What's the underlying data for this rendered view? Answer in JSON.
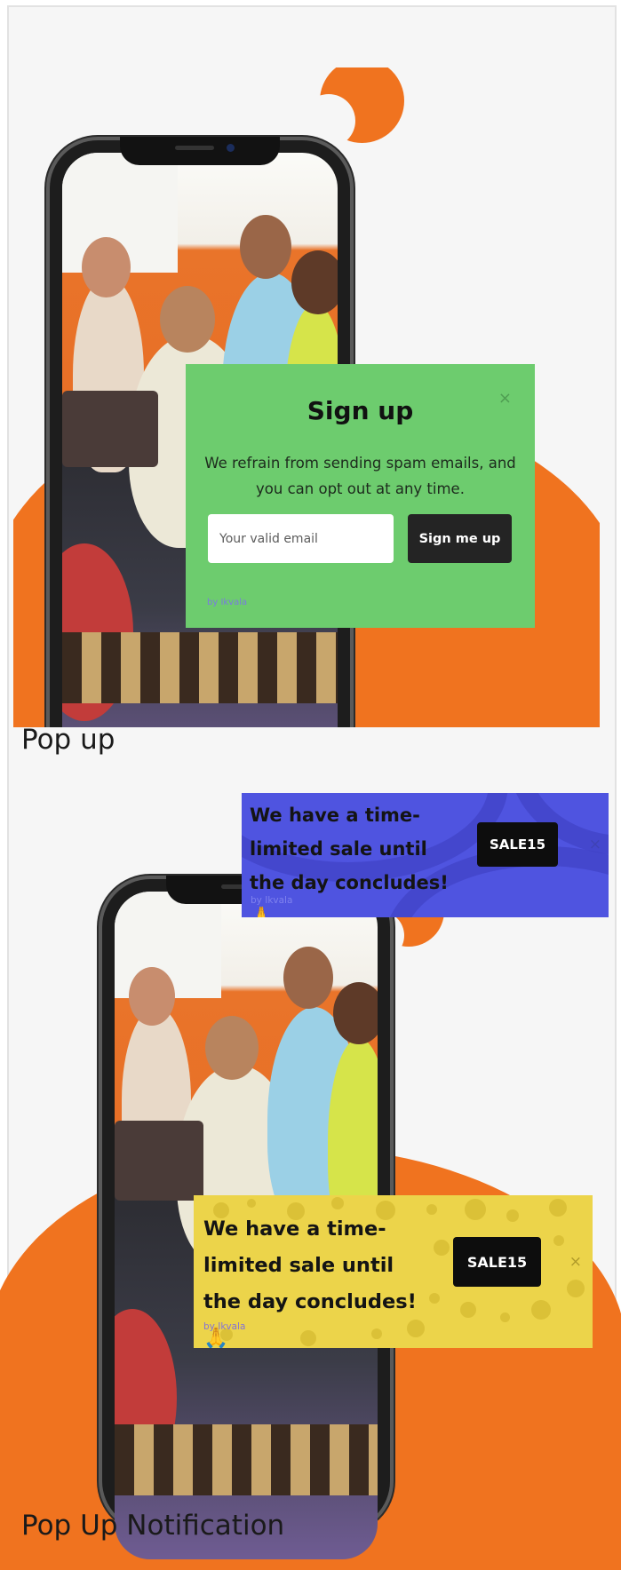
{
  "colors": {
    "accent_orange": "#f0731f",
    "signup_bg": "#6dcc6e",
    "sale_blue_bg": "#4f54e0",
    "sale_yellow_bg": "#ecd44a",
    "button_dark": "#242424"
  },
  "examples": [
    {
      "label": "Pop up",
      "signup": {
        "title": "Sign up",
        "description": "We refrain from sending spam emails, and you can opt out at any time.",
        "email_placeholder": "Your valid email",
        "submit_label": "Sign me up",
        "close_icon": "×",
        "branding": "by Ikvala"
      }
    },
    {
      "label": "Pop Up Notification",
      "notifications": [
        {
          "text": "We have a time-limited sale until the day concludes! 🙏",
          "code_label": "SALE15",
          "close_icon": "×",
          "branding": "by Ikvala"
        },
        {
          "text": "We have a time-limited sale until the day concludes! 🙏",
          "code_label": "SALE15",
          "close_icon": "×",
          "branding": "by Ikvala"
        }
      ]
    }
  ]
}
